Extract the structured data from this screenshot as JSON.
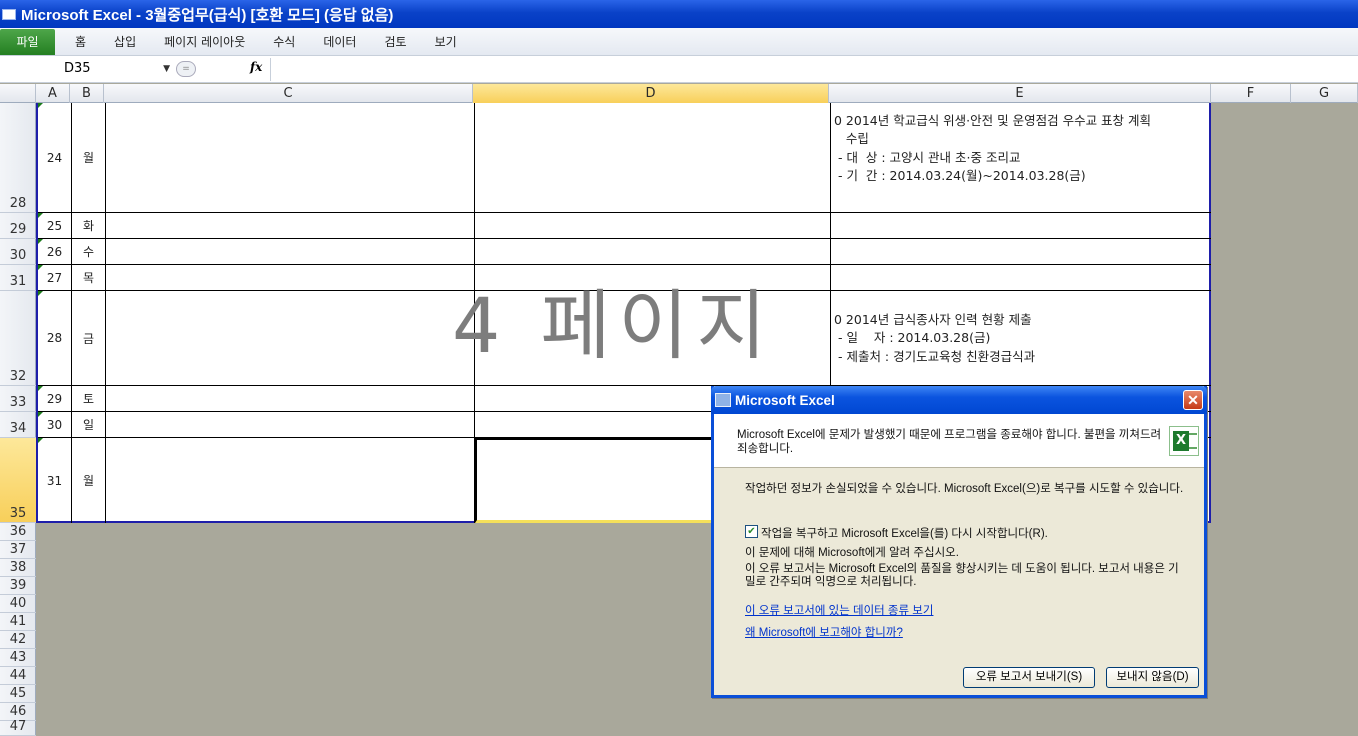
{
  "window": {
    "title": "Microsoft Excel - 3월중업무(급식)  [호환 모드] (응답 없음)"
  },
  "ribbon": {
    "file_tab": "파일",
    "tabs": [
      "홈",
      "삽입",
      "페이지 레이아웃",
      "수식",
      "데이터",
      "검토",
      "보기"
    ]
  },
  "formula_bar": {
    "name_box": "D35",
    "fx": "fx",
    "content": ""
  },
  "columns": [
    "A",
    "B",
    "C",
    "D",
    "E",
    "F",
    "G"
  ],
  "rows": [
    "28",
    "29",
    "30",
    "31",
    "32",
    "33",
    "34",
    "35",
    "36",
    "37",
    "38",
    "39",
    "40",
    "41",
    "42",
    "43",
    "44",
    "45",
    "46",
    "47"
  ],
  "sheet_rows": [
    {
      "row": "28",
      "day": "24",
      "weekday": "월",
      "e": "0 2014년 학교급식 위생·안전 및 운영점검 우수교 표창 계획\n   수립\n - 대  상 : 고양시 관내 초·중 조리교\n - 기  간 : 2014.03.24(월)~2014.03.28(금)"
    },
    {
      "row": "29",
      "day": "25",
      "weekday": "화",
      "e": ""
    },
    {
      "row": "30",
      "day": "26",
      "weekday": "수",
      "e": ""
    },
    {
      "row": "31",
      "day": "27",
      "weekday": "목",
      "e": ""
    },
    {
      "row": "32",
      "day": "28",
      "weekday": "금",
      "e": "0 2014년 급식종사자 인력 현황 제출\n - 일    자 : 2014.03.28(금)\n - 제출처 : 경기도교육청 친환경급식과"
    },
    {
      "row": "33",
      "day": "29",
      "weekday": "토",
      "e": ""
    },
    {
      "row": "34",
      "day": "30",
      "weekday": "일",
      "e": ""
    },
    {
      "row": "35",
      "day": "31",
      "weekday": "월",
      "e": ""
    }
  ],
  "watermark": "4 페이지",
  "dialog": {
    "title": "Microsoft Excel",
    "message": "Microsoft Excel에 문제가 발생했기 때문에 프로그램을 종료해야 합니다. 불편을 끼쳐드려 죄송합니다.",
    "info_loss": "작업하던 정보가 손실되었을 수 있습니다. Microsoft Excel(으)로 복구를 시도할 수 있습니다.",
    "checkbox_label": "작업을 복구하고 Microsoft Excel을(를) 다시 시작합니다(R).",
    "report_prompt": "이 문제에 대해 Microsoft에게 알려 주십시오.",
    "report_detail": "이 오류 보고서는 Microsoft Excel의 품질을 향상시키는 데 도움이 됩니다. 보고서 내용은 기밀로 간주되며 익명으로 처리됩니다.",
    "link_data": "이 오류 보고서에 있는 데이터 종류 보기",
    "link_why": "왜 Microsoft에 보고해야 합니까?",
    "send_button": "오류 보고서 보내기(S)",
    "dont_send_button": "보내지 않음(D)",
    "close_glyph": "✕",
    "checked_glyph": "✔"
  }
}
